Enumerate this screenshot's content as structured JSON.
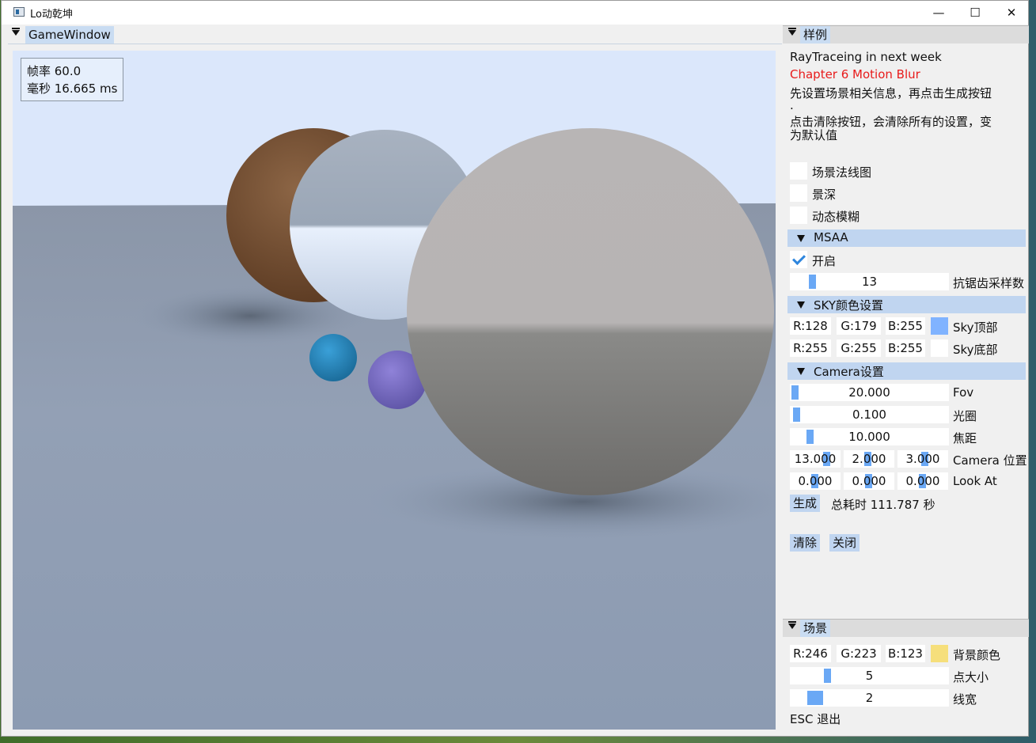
{
  "window": {
    "title": "Lo动乾坤",
    "minimize": "—",
    "maximize": "☐",
    "close": "✕"
  },
  "game_window": {
    "tab": "GameWindow",
    "fps_label": "帧率 60.0",
    "ms_label": "毫秒 16.665 ms"
  },
  "sample": {
    "tab": "样例",
    "line1": "RayTraceing in next week",
    "line2": "Chapter 6 Motion Blur",
    "line3": "先设置场景相关信息，再点击生成按钮",
    "line3b": ".",
    "line4": "点击清除按钮，会清除所有的设置，变",
    "line4b": "为默认值",
    "checkboxes": [
      {
        "label": "场景法线图",
        "checked": false
      },
      {
        "label": "景深",
        "checked": false
      },
      {
        "label": "动态模糊",
        "checked": false
      }
    ],
    "msaa": {
      "header": "MSAA",
      "enable_label": "开启",
      "enabled": true,
      "samples": "13",
      "samples_label": "抗锯齿采样数"
    },
    "sky": {
      "header": "SKY颜色设置",
      "top": {
        "r": "R:128",
        "g": "G:179",
        "b": "B:255",
        "color": "#80b3ff",
        "label": "Sky顶部"
      },
      "bottom": {
        "r": "R:255",
        "g": "G:255",
        "b": "B:255",
        "color": "#ffffff",
        "label": "Sky底部"
      }
    },
    "camera": {
      "header": "Camera设置",
      "fov": "20.000",
      "fov_label": "Fov",
      "aperture": "0.100",
      "aperture_label": "光圈",
      "focus": "10.000",
      "focus_label": "焦距",
      "pos": [
        "13.000",
        "2.000",
        "3.000"
      ],
      "pos_label": "Camera 位置",
      "look": [
        "0.000",
        "0.000",
        "0.000"
      ],
      "look_label": "Look At"
    },
    "generate_button": "生成",
    "total_time": "总耗时 111.787 秒",
    "clear_button": "清除",
    "close_button": "关闭"
  },
  "scene": {
    "tab": "场景",
    "bg": {
      "r": "R:246",
      "g": "G:223",
      "b": "B:123",
      "color": "#f6df7b",
      "label": "背景颜色"
    },
    "point_size": "5",
    "point_size_label": "点大小",
    "line_width": "2",
    "line_width_label": "线宽",
    "esc": "ESC 退出"
  }
}
